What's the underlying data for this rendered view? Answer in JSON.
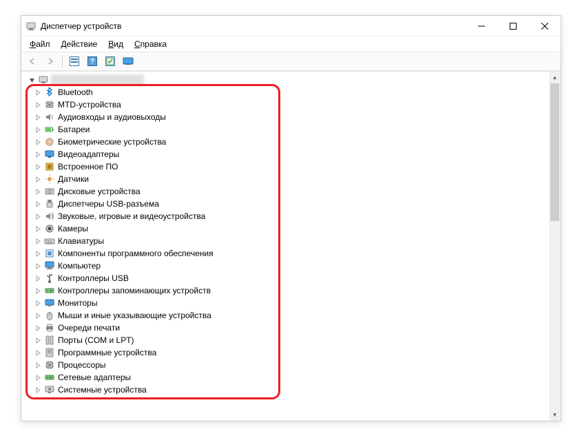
{
  "window": {
    "title": "Диспетчер устройств"
  },
  "menu": {
    "items": [
      {
        "label": "Файл",
        "accel": "Ф"
      },
      {
        "label": "Действие",
        "accel": "Д"
      },
      {
        "label": "Вид",
        "accel": "В"
      },
      {
        "label": "Справка",
        "accel": "С"
      }
    ]
  },
  "toolbar": {
    "back": "back",
    "forward": "forward",
    "properties": "properties",
    "help": "?",
    "scan": "scan",
    "show": "show"
  },
  "tree": {
    "root": {
      "label": "(computer name)",
      "expanded": true
    },
    "items": [
      {
        "label": "Bluetooth",
        "icon": "bluetooth"
      },
      {
        "label": "MTD-устройства",
        "icon": "chip"
      },
      {
        "label": "Аудиовходы и аудиовыходы",
        "icon": "speaker"
      },
      {
        "label": "Батареи",
        "icon": "battery"
      },
      {
        "label": "Биометрические устройства",
        "icon": "fingerprint"
      },
      {
        "label": "Видеоадаптеры",
        "icon": "display-adapter"
      },
      {
        "label": "Встроенное ПО",
        "icon": "firmware"
      },
      {
        "label": "Датчики",
        "icon": "sensor"
      },
      {
        "label": "Дисковые устройства",
        "icon": "disk"
      },
      {
        "label": "Диспетчеры USB-разъема",
        "icon": "usb-connector"
      },
      {
        "label": "Звуковые, игровые и видеоустройства",
        "icon": "sound"
      },
      {
        "label": "Камеры",
        "icon": "camera"
      },
      {
        "label": "Клавиатуры",
        "icon": "keyboard"
      },
      {
        "label": "Компоненты программного обеспечения",
        "icon": "software-component"
      },
      {
        "label": "Компьютер",
        "icon": "computer"
      },
      {
        "label": "Контроллеры USB",
        "icon": "usb"
      },
      {
        "label": "Контроллеры запоминающих устройств",
        "icon": "storage-controller"
      },
      {
        "label": "Мониторы",
        "icon": "monitor"
      },
      {
        "label": "Мыши и иные указывающие устройства",
        "icon": "mouse"
      },
      {
        "label": "Очереди печати",
        "icon": "print-queue"
      },
      {
        "label": "Порты (COM и LPT)",
        "icon": "port"
      },
      {
        "label": "Программные устройства",
        "icon": "software-device"
      },
      {
        "label": "Процессоры",
        "icon": "cpu"
      },
      {
        "label": "Сетевые адаптеры",
        "icon": "network"
      },
      {
        "label": "Системные устройства",
        "icon": "system"
      }
    ]
  }
}
